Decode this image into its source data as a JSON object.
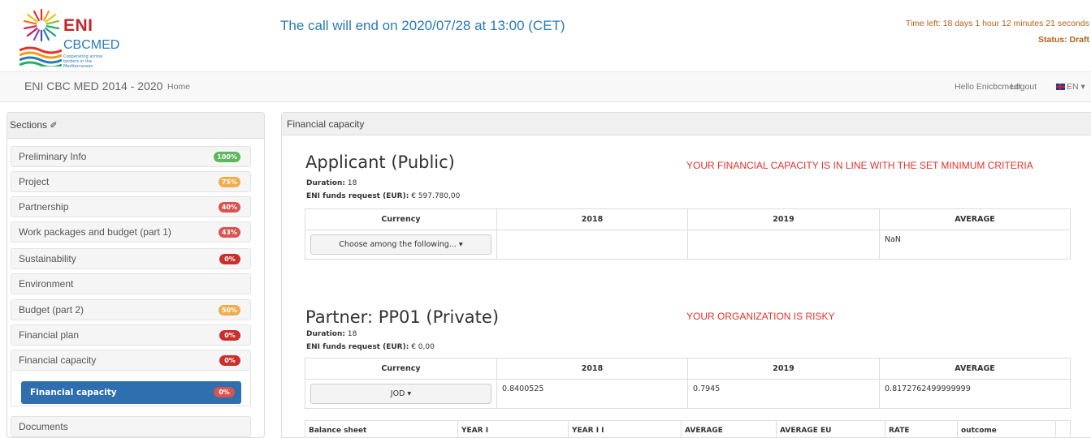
{
  "logo": {
    "eni": "ENI",
    "cbcmed": "CBCMED",
    "tagline": "Cooperating across borders in the Mediterranean"
  },
  "header": {
    "call_end": "The call will end on 2020/07/28 at 13:00 (CET)",
    "time_left": "Time left: 18 days 1 hour 12 minutes 21 seconds",
    "status": "Status: Draft"
  },
  "navbar": {
    "brand": "ENI CBC MED 2014 - 2020",
    "home": "Home",
    "hello": "Hello Enicbcmed!",
    "logout": "Logout",
    "lang": "EN ▾"
  },
  "sidebar": {
    "title": "Sections",
    "items": [
      {
        "label": "Preliminary Info",
        "badge": "100%",
        "color": "#5cb85c"
      },
      {
        "label": "Project",
        "badge": "75%",
        "color": "#f0ad4e"
      },
      {
        "label": "Partnership",
        "badge": "40%",
        "color": "#d9534f"
      },
      {
        "label": "Work packages and budget (part 1)",
        "badge": "43%",
        "color": "#d9534f"
      },
      {
        "label": "Sustainability",
        "badge": "0%",
        "color": "#d9534f"
      },
      {
        "label": "Environment",
        "badge": "",
        "color": ""
      },
      {
        "label": "Budget (part 2)",
        "badge": "50%",
        "color": "#f0ad4e"
      },
      {
        "label": "Financial plan",
        "badge": "0%",
        "color": "#d9534f"
      },
      {
        "label": "Financial capacity",
        "badge": "0%",
        "color": "#d9534f"
      },
      {
        "label": "Documents",
        "badge": "",
        "color": ""
      }
    ],
    "sub_active": {
      "label": "Financial capacity",
      "badge": "0%"
    }
  },
  "main": {
    "title": "Financial capacity",
    "applicant": {
      "title": "Applicant (Public)",
      "message": "YOUR FINANCIAL CAPACITY IS IN LINE WITH THE SET MINIMUM CRITERIA",
      "duration_label": "Duration:",
      "duration": "18",
      "funds_label": "ENI funds request (EUR):",
      "funds": "€ 597.780,00",
      "headers": [
        "Currency",
        "2018",
        "2019",
        "AVERAGE"
      ],
      "currency_dropdown": "Choose among the following... ▾",
      "y2018": "",
      "y2019": "",
      "average": "NaN"
    },
    "partner": {
      "title": "Partner:  PP01 (Private)",
      "message": "YOUR ORGANIZATION IS RISKY",
      "duration_label": "Duration:",
      "duration": "18",
      "funds_label": "ENI funds request (EUR):",
      "funds": "€ 0,00",
      "headers": [
        "Currency",
        "2018",
        "2019",
        "AVERAGE"
      ],
      "currency_dropdown": "JOD ▾",
      "y2018": "0.8400525",
      "y2019": "0.7945",
      "average": "0.8172762499999999"
    },
    "balance_headers": [
      "Balance sheet",
      "YEAR I",
      "YEAR I I",
      "AVERAGE",
      "AVERAGE EU",
      "RATE",
      "outcome",
      ""
    ]
  }
}
